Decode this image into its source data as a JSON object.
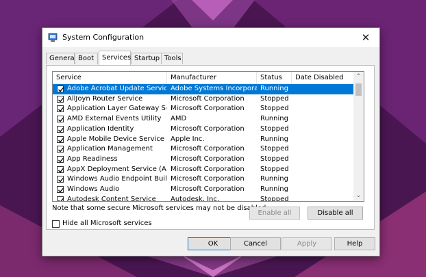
{
  "window": {
    "title": "System Configuration"
  },
  "tabs": [
    "General",
    "Boot",
    "Services",
    "Startup",
    "Tools"
  ],
  "active_tab": "Services",
  "columns": [
    "Service",
    "Manufacturer",
    "Status",
    "Date Disabled"
  ],
  "services": [
    {
      "name": "Adobe Acrobat Update Service",
      "manufacturer": "Adobe Systems Incorporated",
      "status": "Running",
      "checked": true,
      "selected": true
    },
    {
      "name": "AllJoyn Router Service",
      "manufacturer": "Microsoft Corporation",
      "status": "Stopped",
      "checked": true
    },
    {
      "name": "Application Layer Gateway Service",
      "manufacturer": "Microsoft Corporation",
      "status": "Stopped",
      "checked": true
    },
    {
      "name": "AMD External Events Utility",
      "manufacturer": "AMD",
      "status": "Running",
      "checked": true
    },
    {
      "name": "Application Identity",
      "manufacturer": "Microsoft Corporation",
      "status": "Stopped",
      "checked": true
    },
    {
      "name": "Apple Mobile Device Service",
      "manufacturer": "Apple Inc.",
      "status": "Running",
      "checked": true
    },
    {
      "name": "Application Management",
      "manufacturer": "Microsoft Corporation",
      "status": "Stopped",
      "checked": true
    },
    {
      "name": "App Readiness",
      "manufacturer": "Microsoft Corporation",
      "status": "Stopped",
      "checked": true
    },
    {
      "name": "AppX Deployment Service (AppX...",
      "manufacturer": "Microsoft Corporation",
      "status": "Stopped",
      "checked": true
    },
    {
      "name": "Windows Audio Endpoint Builder",
      "manufacturer": "Microsoft Corporation",
      "status": "Running",
      "checked": true
    },
    {
      "name": "Windows Audio",
      "manufacturer": "Microsoft Corporation",
      "status": "Running",
      "checked": true
    },
    {
      "name": "Autodesk Content Service",
      "manufacturer": "Autodesk, Inc.",
      "status": "Stopped",
      "checked": true
    }
  ],
  "note": "Note that some secure Microsoft services may not be disabled.",
  "enable_all_label": "Enable all",
  "disable_all_label": "Disable all",
  "hide_ms_label": "Hide all Microsoft services",
  "hide_ms_checked": false,
  "buttons": {
    "ok": "OK",
    "cancel": "Cancel",
    "apply": "Apply",
    "help": "Help"
  },
  "colors": {
    "selection": "#0078d7",
    "background_purple": "#5d1f63"
  }
}
